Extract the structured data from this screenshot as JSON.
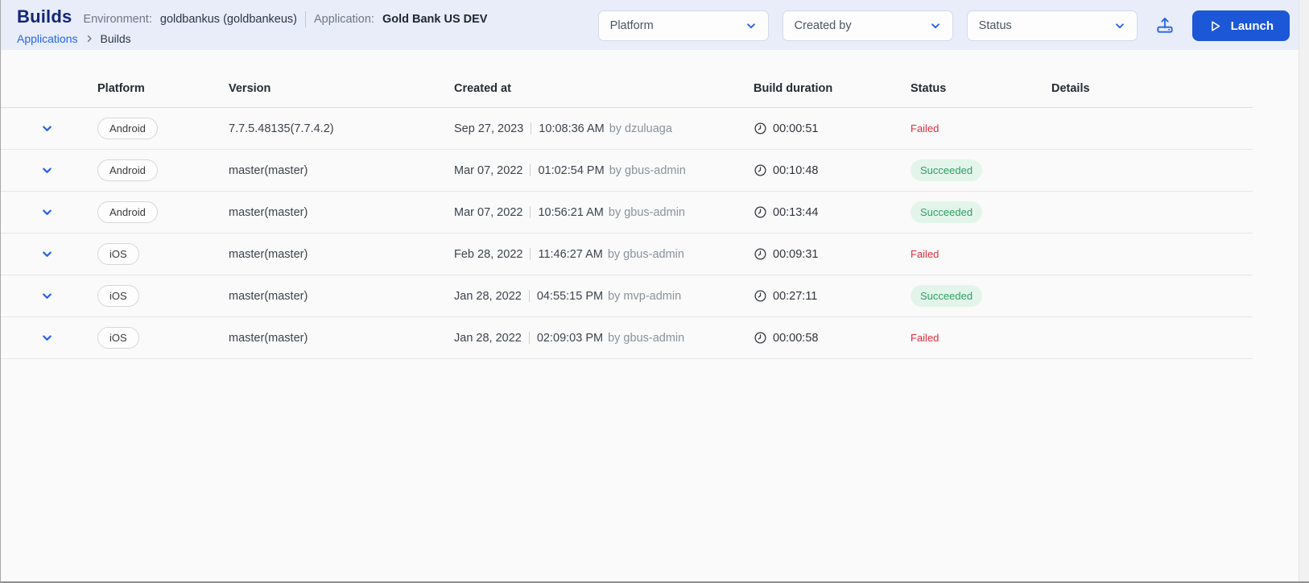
{
  "header": {
    "title": "Builds",
    "environment_label": "Environment:",
    "environment_value": "goldbankus (goldbankeus)",
    "application_label": "Application:",
    "application_value": "Gold Bank US DEV",
    "breadcrumb": [
      {
        "label": "Applications"
      },
      {
        "label": "Builds"
      }
    ]
  },
  "filters": [
    {
      "placeholder": "Platform",
      "icon": "chevron-down-icon"
    },
    {
      "placeholder": "Created by",
      "icon": "chevron-down-icon"
    },
    {
      "placeholder": "Status",
      "icon": "chevron-down-icon"
    }
  ],
  "actions": {
    "upload_icon": "upload-icon",
    "launch_label": "Launch",
    "launch_icon": "play-icon"
  },
  "table": {
    "columns": {
      "platform": "Platform",
      "version": "Version",
      "created_at": "Created at",
      "build_duration": "Build duration",
      "status": "Status",
      "details": "Details"
    },
    "rows": [
      {
        "platform": "Android",
        "version": "7.7.5.48135(7.7.4.2)",
        "date": "Sep 27, 2023",
        "time": "10:08:36 AM",
        "by": "by dzuluaga",
        "duration": "00:00:51",
        "status": "Failed"
      },
      {
        "platform": "Android",
        "version": "master(master)",
        "date": "Mar 07, 2022",
        "time": "01:02:54 PM",
        "by": "by gbus-admin",
        "duration": "00:10:48",
        "status": "Succeeded"
      },
      {
        "platform": "Android",
        "version": "master(master)",
        "date": "Mar 07, 2022",
        "time": "10:56:21 AM",
        "by": "by gbus-admin",
        "duration": "00:13:44",
        "status": "Succeeded"
      },
      {
        "platform": "iOS",
        "version": "master(master)",
        "date": "Feb 28, 2022",
        "time": "11:46:27 AM",
        "by": "by gbus-admin",
        "duration": "00:09:31",
        "status": "Failed"
      },
      {
        "platform": "iOS",
        "version": "master(master)",
        "date": "Jan 28, 2022",
        "time": "04:55:15 PM",
        "by": "by mvp-admin",
        "duration": "00:27:11",
        "status": "Succeeded"
      },
      {
        "platform": "iOS",
        "version": "master(master)",
        "date": "Jan 28, 2022",
        "time": "02:09:03 PM",
        "by": "by gbus-admin",
        "duration": "00:00:58",
        "status": "Failed"
      }
    ]
  },
  "colors": {
    "topbar_bg": "#e8edf9",
    "accent_blue": "#2563eb",
    "button_blue": "#1b57d6",
    "title_navy": "#14267b",
    "failed_red": "#e02d3c",
    "succeeded_green": "#2f9e63",
    "succeeded_bg": "#e3f5ea"
  }
}
